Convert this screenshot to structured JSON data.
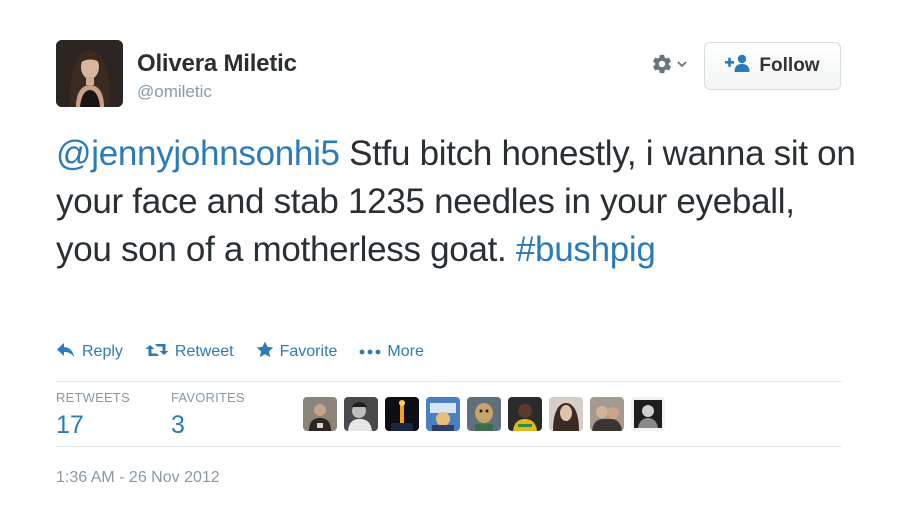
{
  "author": {
    "display_name": "Olivera Miletic",
    "screen_name": "@omiletic"
  },
  "header": {
    "follow_label": "Follow"
  },
  "tweet": {
    "mention": "@jennyjohnsonhi5",
    "body": " Stfu bitch honestly, i wanna sit on your face and stab 1235 needles in your eyeball, you son of a motherless goat. ",
    "hashtag": "#bushpig"
  },
  "actions": {
    "reply": "Reply",
    "retweet": "Retweet",
    "favorite": "Favorite",
    "more": "More"
  },
  "stats": {
    "retweets_label": "RETWEETS",
    "retweets_count": "17",
    "favorites_label": "FAVORITES",
    "favorites_count": "3"
  },
  "timestamp": "1:36 AM - 26 Nov 2012",
  "colors": {
    "link": "#2b7bb9",
    "muted": "#8899a6",
    "text": "#292f33",
    "divider": "#e1e8ed"
  },
  "icons": {
    "reply": "reply-arrow-icon",
    "retweet": "retweet-icon",
    "favorite": "star-icon",
    "more": "ellipsis-icon",
    "settings": "gear-icon",
    "follow": "add-user-icon"
  }
}
